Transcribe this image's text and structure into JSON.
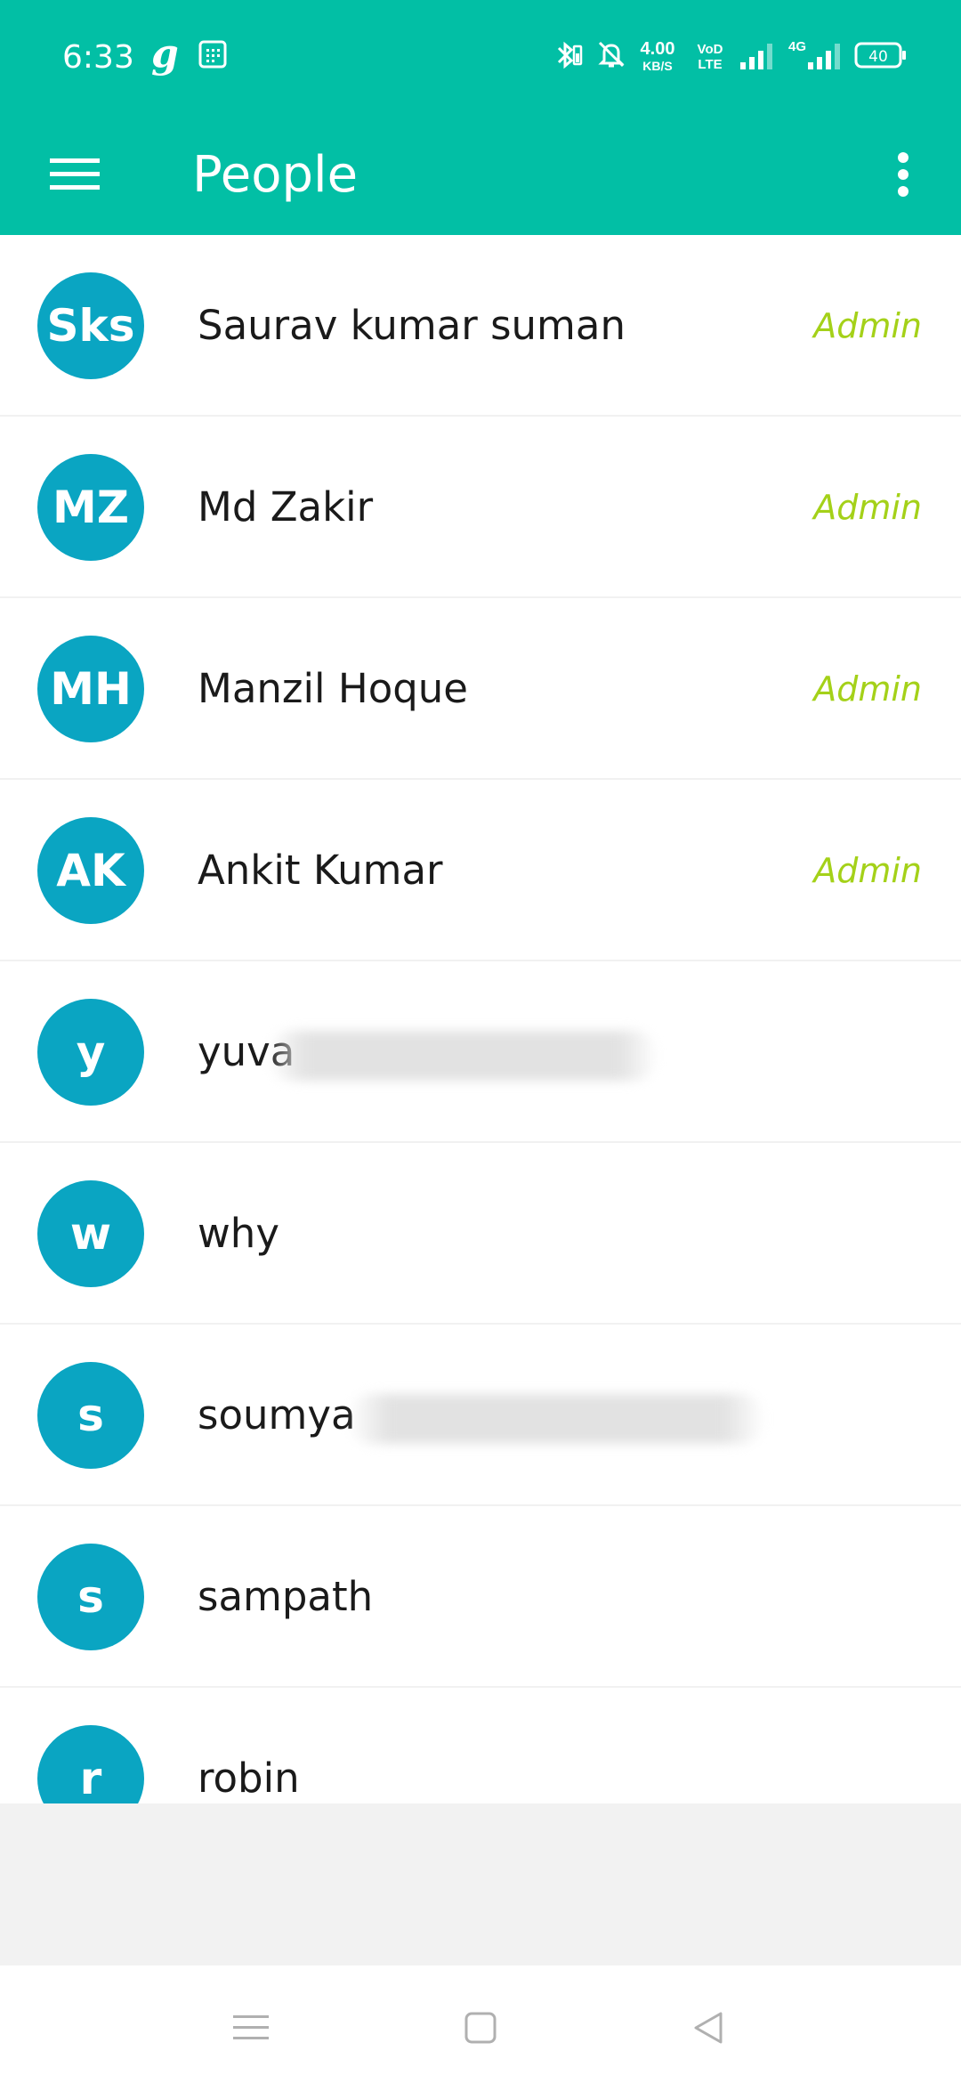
{
  "status_bar": {
    "time": "6:33",
    "g_label": "g",
    "speed_value": "4.00",
    "speed_unit": "KB/S",
    "vod_top": "VoD",
    "vod_bottom": "LTE",
    "network": "4G",
    "battery": "40"
  },
  "app_bar": {
    "title": "People",
    "menu_icon": "hamburger-menu-icon",
    "overflow_icon": "more-vert-icon"
  },
  "colors": {
    "primary": "#02bfa5",
    "avatar": "#0aa5c2",
    "admin": "#a4d119"
  },
  "people": [
    {
      "initials": "Sks",
      "name": "Saurav kumar suman",
      "role": "Admin"
    },
    {
      "initials": "MZ",
      "name": "Md Zakir",
      "role": "Admin"
    },
    {
      "initials": "MH",
      "name": "Manzil Hoque",
      "role": "Admin"
    },
    {
      "initials": "AK",
      "name": "Ankit Kumar",
      "role": "Admin"
    },
    {
      "initials": "y",
      "name": "yuva",
      "role": ""
    },
    {
      "initials": "w",
      "name": "why",
      "role": ""
    },
    {
      "initials": "s",
      "name": "soumya",
      "role": ""
    },
    {
      "initials": "s",
      "name": "sampath",
      "role": ""
    },
    {
      "initials": "r",
      "name": "robin",
      "role": ""
    }
  ],
  "nav_bar": {
    "recent_icon": "recent-apps-icon",
    "home_icon": "home-icon",
    "back_icon": "back-icon"
  }
}
